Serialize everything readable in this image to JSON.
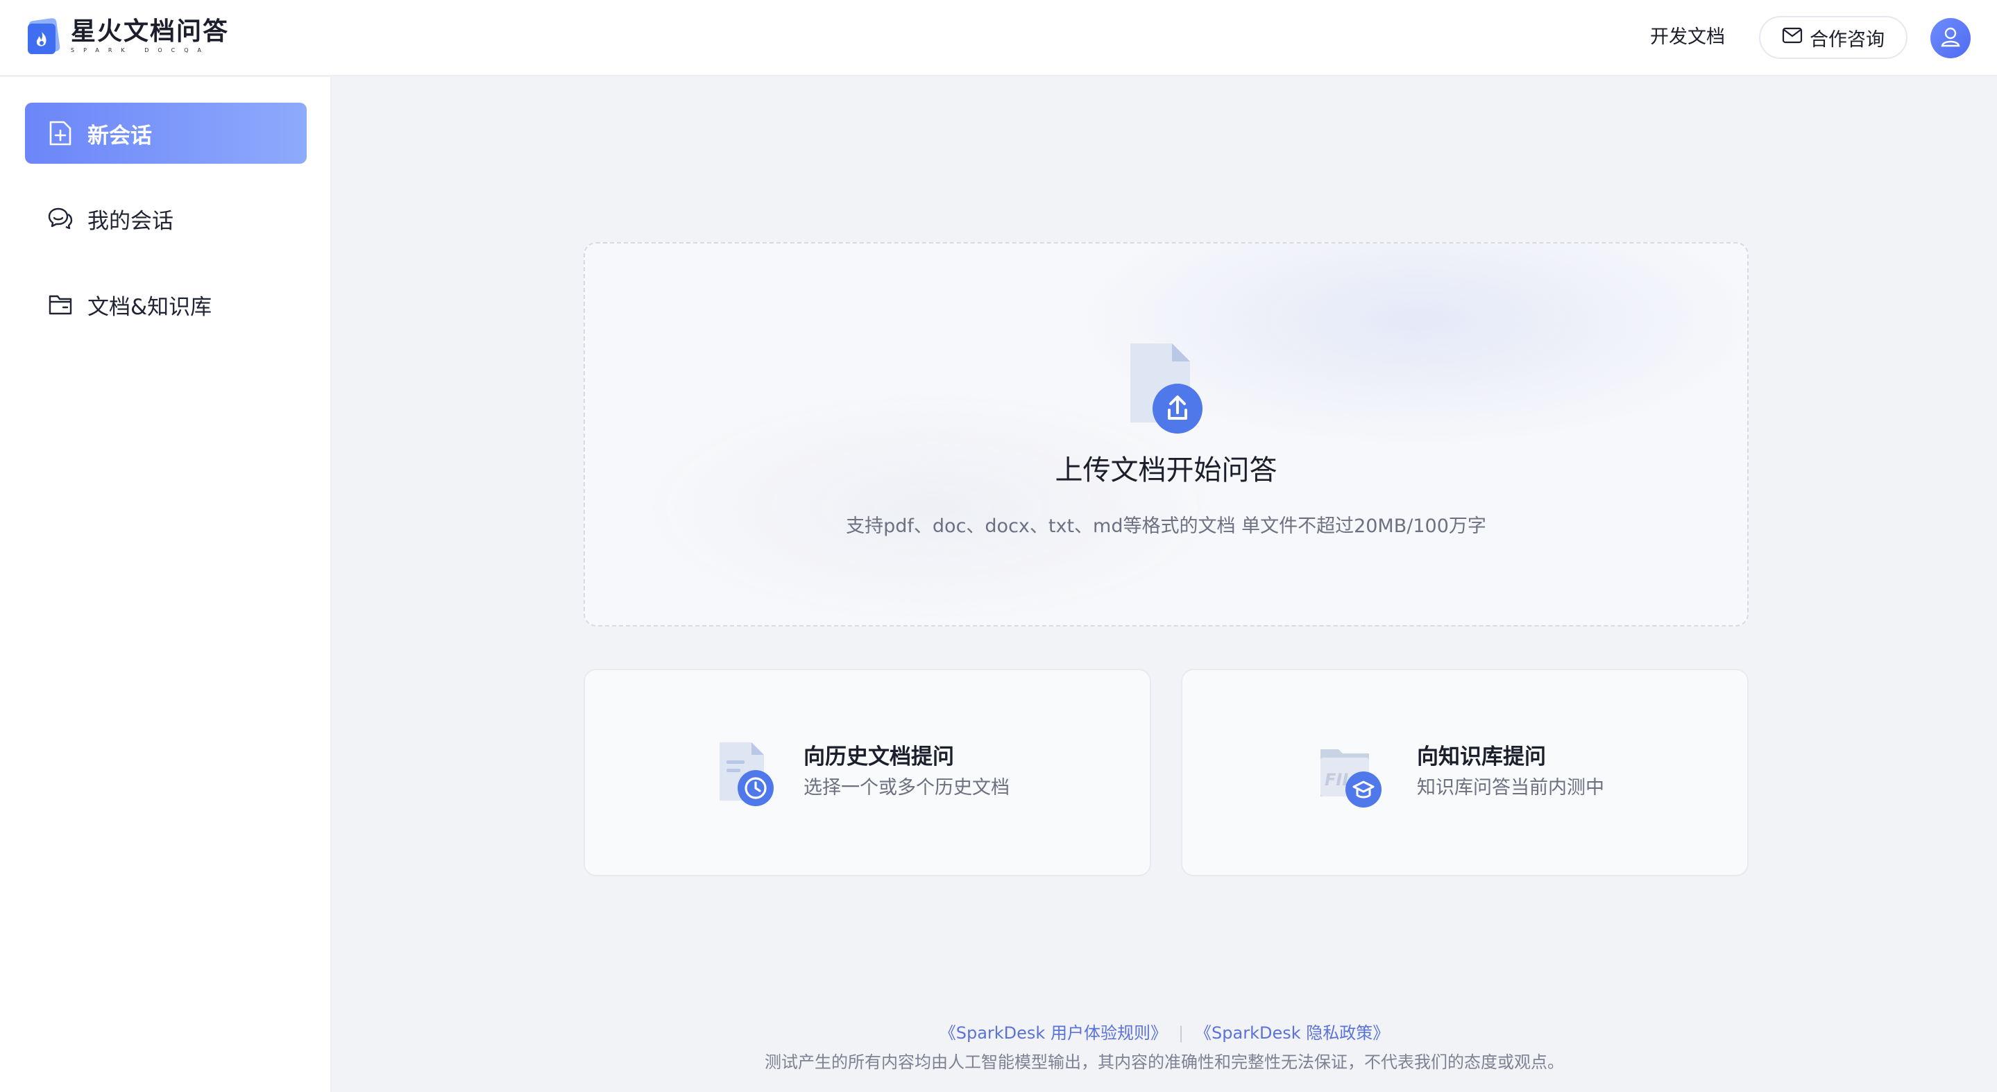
{
  "header": {
    "logo_title": "星火文档问答",
    "logo_subtitle": "SPARK DOCQA",
    "dev_docs_label": "开发文档",
    "contact_label": "合作咨询"
  },
  "sidebar": {
    "items": [
      {
        "label": "新会话",
        "icon": "new-document-icon",
        "active": true
      },
      {
        "label": "我的会话",
        "icon": "chat-bubbles-icon",
        "active": false
      },
      {
        "label": "文档&知识库",
        "icon": "folder-icon",
        "active": false
      }
    ]
  },
  "upload": {
    "title": "上传文档开始问答",
    "description": "支持pdf、doc、docx、txt、md等格式的文档 单文件不超过20MB/100万字"
  },
  "cards": {
    "history": {
      "title": "向历史文档提问",
      "description": "选择一个或多个历史文档"
    },
    "knowledge": {
      "title": "向知识库提问",
      "description": "知识库问答当前内测中"
    }
  },
  "footer": {
    "link_terms": "《SparkDesk 用户体验规则》",
    "link_privacy": "《SparkDesk 隐私政策》",
    "separator": "|",
    "note": "测试产生的所有内容均由人工智能模型输出，其内容的准确性和完整性无法保证，不代表我们的态度或观点。"
  },
  "colors": {
    "accent": "#6b86f8",
    "accent_light": "#8eaafc",
    "link": "#5b72d8",
    "icon_blue": "#4f78ea"
  }
}
